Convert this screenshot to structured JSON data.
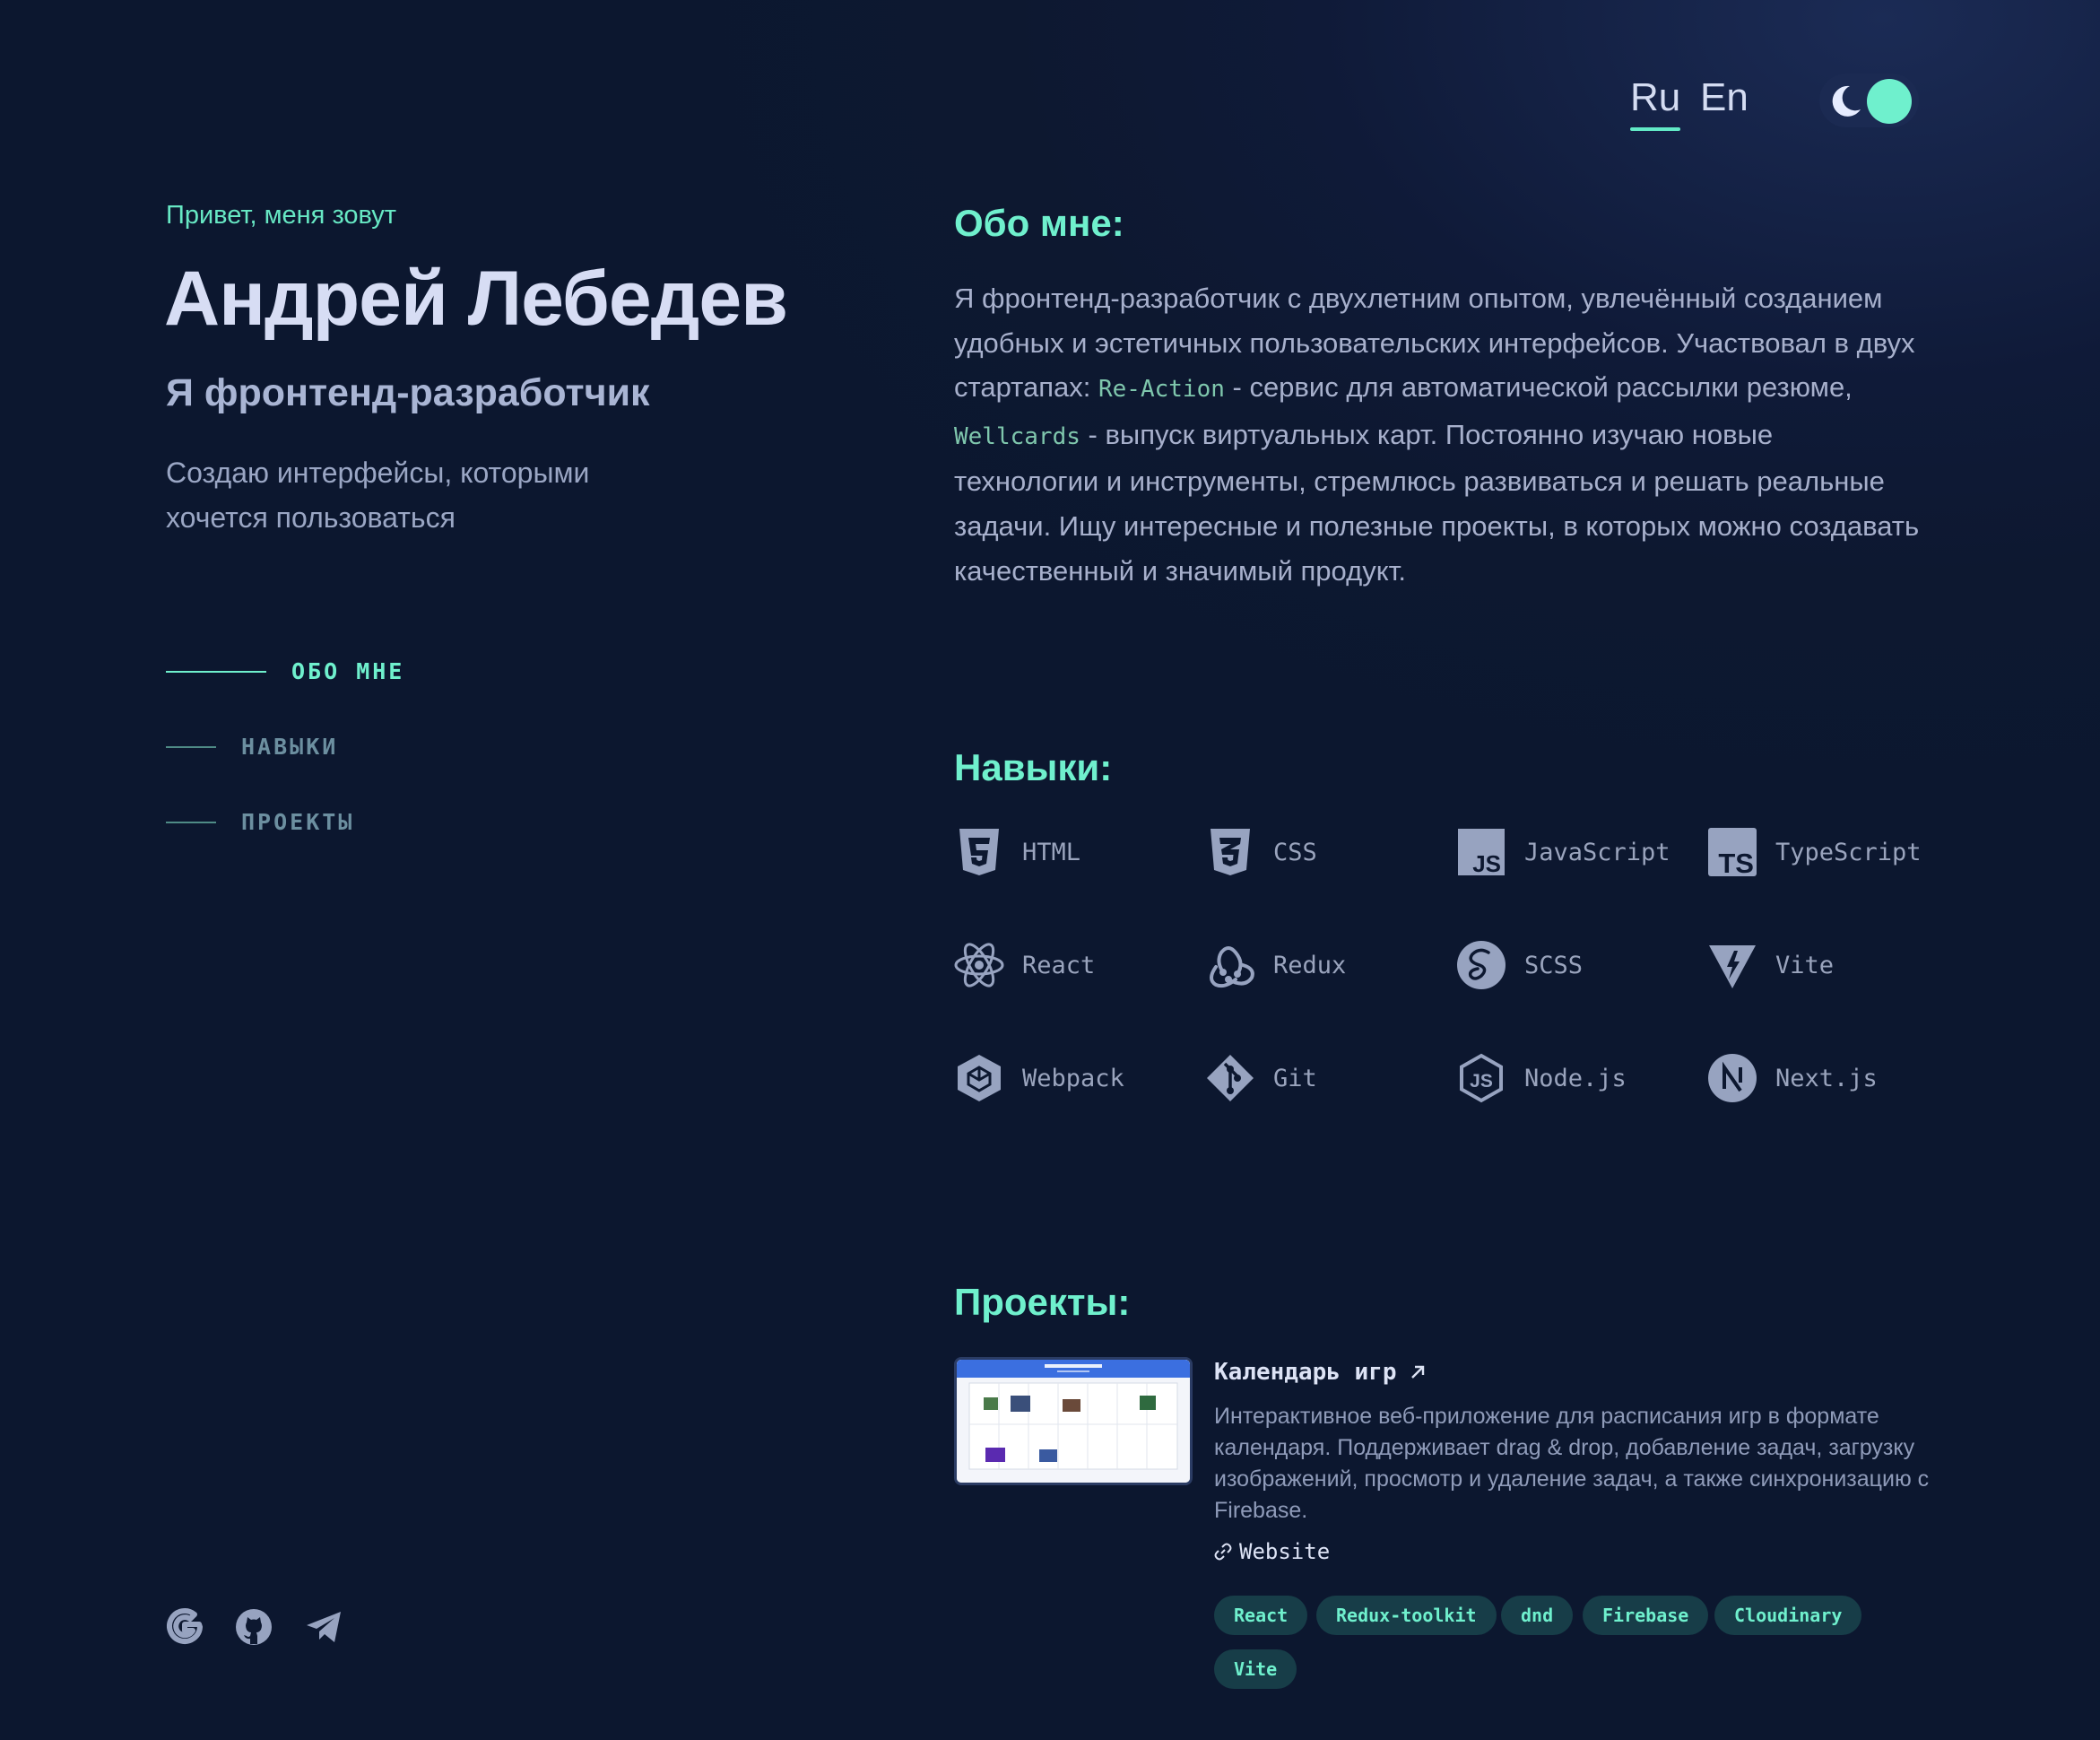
{
  "header": {
    "lang_ru": "Ru",
    "lang_en": "En",
    "theme_toggle_icon": "moon-icon"
  },
  "intro": {
    "greeting": "Привет, меня зовут",
    "name": "Андрей Лебедев",
    "role": "Я фронтенд-разработчик",
    "tagline": "Создаю интерфейсы, которыми хочется пользоваться"
  },
  "nav": {
    "about": "ОБО МНЕ",
    "skills": "НАВЫКИ",
    "projects": "ПРОЕКТЫ"
  },
  "social": [
    {
      "name": "google-icon"
    },
    {
      "name": "github-icon"
    },
    {
      "name": "telegram-icon"
    }
  ],
  "about": {
    "title": "Обо мне:",
    "text_1": "Я фронтенд-разработчик с двухлетним опытом, увлечённый созданием удобных и эстетичных пользовательских интерфейсов. Участвовал в двух стартапах: ",
    "startup_1": "Re-Action",
    "text_2": " - сервис для автоматической рассылки резюме, ",
    "startup_2": "Wellcards",
    "text_3": " - выпуск виртуальных карт. Постоянно изучаю новые технологии и инструменты, стремлюсь развиваться и решать реальные задачи. Ищу интересные и полезные проекты, в которых можно создавать качественный и значимый продукт."
  },
  "skills": {
    "title": "Навыки:",
    "items": [
      {
        "label": "HTML",
        "icon": "html5-icon"
      },
      {
        "label": "CSS",
        "icon": "css3-icon"
      },
      {
        "label": "JavaScript",
        "icon": "javascript-icon"
      },
      {
        "label": "TypeScript",
        "icon": "typescript-icon"
      },
      {
        "label": "React",
        "icon": "react-icon"
      },
      {
        "label": "Redux",
        "icon": "redux-icon"
      },
      {
        "label": "SCSS",
        "icon": "sass-icon"
      },
      {
        "label": "Vite",
        "icon": "vite-icon"
      },
      {
        "label": "Webpack",
        "icon": "webpack-icon"
      },
      {
        "label": "Git",
        "icon": "git-icon"
      },
      {
        "label": "Node.js",
        "icon": "nodejs-icon"
      },
      {
        "label": "Next.js",
        "icon": "nextjs-icon"
      }
    ]
  },
  "projects": {
    "title": "Проекты:",
    "items": [
      {
        "title": "Календарь игр",
        "description": "Интерактивное веб-приложение для расписания игр в формате календаря. Поддерживает drag & drop, добавление задач, загрузку изображений, просмотр и удаление задач, а также синхронизацию с Firebase.",
        "link_label": "Website",
        "tags": [
          "React",
          "Redux-toolkit",
          "dnd",
          "Firebase",
          "Cloudinary",
          "Vite"
        ]
      }
    ]
  },
  "colors": {
    "accent": "#6ff0cd",
    "background": "#0d1830",
    "text": "#a7b0cc",
    "tag_bg": "#173d48"
  }
}
